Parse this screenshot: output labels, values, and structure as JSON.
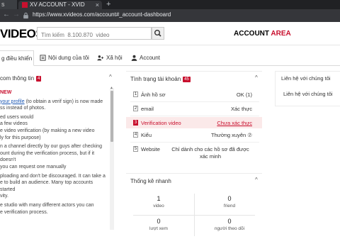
{
  "browser": {
    "prev_tab_label": "s",
    "active_tab_title": "XV ACCOUNT - XVID",
    "close_glyph": "×",
    "new_tab_glyph": "+",
    "url": "https://www.xvideos.com/account#_account-dashboard"
  },
  "header": {
    "logo": "VIDEOS",
    "search_placeholder": "Tìm kiếm  8.100.870  video",
    "account_label": "ACCOUNT",
    "area_label": "AREA"
  },
  "tabs": [
    {
      "label": "g điều khiển",
      "icon": "dashboard-icon"
    },
    {
      "label": "Nội dung của tôi",
      "icon": "content-icon"
    },
    {
      "label": "Xã hội",
      "icon": "social-icon"
    },
    {
      "label": "Account",
      "icon": "user-icon"
    }
  ],
  "left_panel": {
    "title": "com thông tin",
    "badge": "4",
    "lines": [
      {
        "text": "NEW",
        "style": "strong-red"
      },
      {
        "text": "your profile",
        "style": "link",
        "suffix": " (to obtain a verif sign) is now made"
      },
      {
        "text": "ss instead of photos.",
        "style": ""
      },
      {
        "text": "ed users would",
        "style": ""
      },
      {
        "text": "a few videos",
        "style": ""
      },
      {
        "text": "e video verification (by making a new video",
        "style": ""
      },
      {
        "text": "ly for this purpose)",
        "style": ""
      },
      {
        "text": "n a channel directly by our guys after checking",
        "style": ""
      },
      {
        "text": "ount during the verification process, but if it doesn't",
        "style": ""
      },
      {
        "text": "you can request one manually",
        "style": ""
      },
      {
        "text": "ploading and don't be discouraged. It can take a",
        "style": ""
      },
      {
        "text": "e to build an audience. Many top accounts started",
        "style": ""
      },
      {
        "text": "vity.",
        "style": ""
      },
      {
        "text": "e studio with many different actors you can",
        "style": ""
      },
      {
        "text": "e verification process.",
        "style": ""
      }
    ]
  },
  "status_panel": {
    "title": "Tình trạng tài khoản",
    "badge": "45",
    "rows": [
      {
        "num": "1",
        "label": "Ảnh hồ sơ",
        "value": "OK (1)",
        "warn": false
      },
      {
        "num": "2",
        "label": "email",
        "value": "Xác thực",
        "warn": false
      },
      {
        "num": "3",
        "label": "Verification video",
        "value": "Chưa xác thực",
        "warn": true
      },
      {
        "num": "4",
        "label": "Kiểu",
        "value": "Thường xuyên  ⑦",
        "warn": false
      },
      {
        "num": "5",
        "label": "Website",
        "value": "Chỉ dành cho các hồ sơ đã được xác minh",
        "warn": false
      }
    ]
  },
  "stats_panel": {
    "title": "Thống kê nhanh",
    "stats": [
      {
        "value": "1",
        "label": "video"
      },
      {
        "value": "0",
        "label": "friend"
      },
      {
        "value": "0",
        "label": "lượt xem"
      },
      {
        "value": "0",
        "label": "người theo dõi"
      }
    ]
  },
  "contact_panel": {
    "title": "Liên hệ với chúng tôi",
    "link": "Liên hệ với chúng tôi"
  },
  "icons": {
    "chevron_up": "^",
    "scroll_up": "▲"
  }
}
